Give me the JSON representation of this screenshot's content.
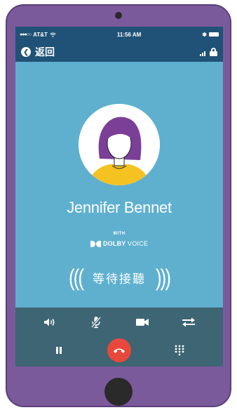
{
  "status_bar": {
    "carrier": "AT&T",
    "signal": "●●●○○",
    "time": "11:56 AM"
  },
  "nav": {
    "back_label": "返回"
  },
  "caller": {
    "name": "Jennifer Bennet"
  },
  "branding": {
    "with_label": "WITH",
    "dolby_bold": "DOLBY",
    "dolby_light": "VOICE"
  },
  "call": {
    "status": "等待接聽",
    "left_waves": "(((",
    "right_waves": ")))"
  },
  "controls": {
    "row1": [
      "speaker-icon",
      "mute-microphone-icon",
      "video-camera-icon",
      "swap-arrows-icon"
    ],
    "row2": [
      "pause-icon",
      "end-call-icon",
      "keypad-icon"
    ]
  },
  "colors": {
    "phone_body": "#7b5a9c",
    "header": "#1f5276",
    "screen_bg": "#5fb0cf",
    "controls_bg": "#3d6573",
    "end_call": "#e8483b",
    "avatar_hair": "#7b3f98",
    "avatar_shirt": "#f4c322"
  }
}
